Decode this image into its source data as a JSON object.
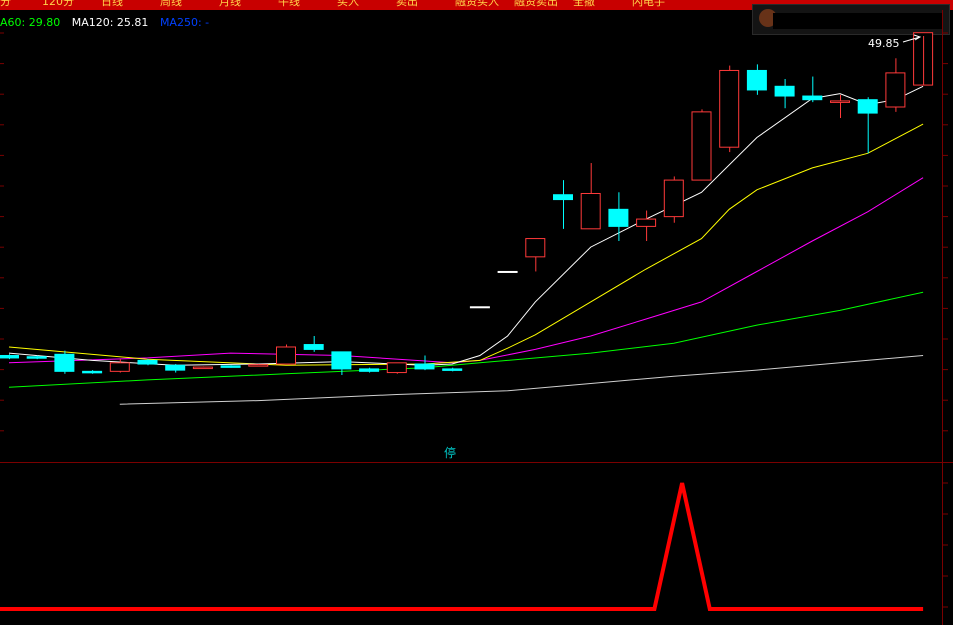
{
  "menu": [
    {
      "label": "分",
      "x": 0
    },
    {
      "label": "120分",
      "x": 42
    },
    {
      "label": "日线",
      "x": 108
    },
    {
      "label": "周线",
      "x": 168
    },
    {
      "label": "月线",
      "x": 232
    },
    {
      "label": "牛线",
      "x": 292
    },
    {
      "label": "买入",
      "x": 356
    },
    {
      "label": "卖出",
      "x": 416
    },
    {
      "label": "融资买入",
      "x": 466
    },
    {
      "label": "融资卖出",
      "x": 530
    },
    {
      "label": "全撤",
      "x": 604
    },
    {
      "label": "闪电手",
      "x": 658
    }
  ],
  "indicators": {
    "ma60": "A60: 29.80",
    "ma120": "MA120: 25.81",
    "ma250": "MA250: -"
  },
  "colors": {
    "ma60": "#00ff00",
    "ma120": "#ffffff",
    "ma250": "#0000ff",
    "up": "#ff3a3a",
    "down": "#00ffff",
    "ma5": "#ffffff",
    "ma10": "#ffff00",
    "ma20": "#ff00ff",
    "ma60_line": "#00ff00",
    "ma120_line": "#d0d0d0",
    "indicator_line": "#ff0000"
  },
  "price_marker": "49.85",
  "stop_label": "停",
  "chart_data": {
    "type": "candlestick",
    "y_range": [
      17.5,
      50.5
    ],
    "candles": [
      {
        "o": 24.6,
        "h": 24.7,
        "l": 24.3,
        "c": 24.4
      },
      {
        "o": 24.5,
        "h": 24.6,
        "l": 24.3,
        "c": 24.45
      },
      {
        "o": 24.7,
        "h": 25.0,
        "l": 23.1,
        "c": 23.3
      },
      {
        "o": 23.3,
        "h": 23.4,
        "l": 23.1,
        "c": 23.25
      },
      {
        "o": 23.3,
        "h": 24.3,
        "l": 23.2,
        "c": 24.0
      },
      {
        "o": 24.2,
        "h": 24.3,
        "l": 23.8,
        "c": 23.9
      },
      {
        "o": 23.8,
        "h": 23.9,
        "l": 23.2,
        "c": 23.4
      },
      {
        "o": 23.6,
        "h": 23.7,
        "l": 23.5,
        "c": 23.65
      },
      {
        "o": 23.75,
        "h": 23.8,
        "l": 23.6,
        "c": 23.7
      },
      {
        "o": 23.8,
        "h": 23.9,
        "l": 23.7,
        "c": 23.85
      },
      {
        "o": 23.9,
        "h": 25.5,
        "l": 23.9,
        "c": 25.3
      },
      {
        "o": 25.5,
        "h": 26.2,
        "l": 24.9,
        "c": 25.1
      },
      {
        "o": 24.9,
        "h": 24.9,
        "l": 23.0,
        "c": 23.5
      },
      {
        "o": 23.5,
        "h": 23.6,
        "l": 23.2,
        "c": 23.3
      },
      {
        "o": 23.2,
        "h": 24.0,
        "l": 23.1,
        "c": 24.0
      },
      {
        "o": 23.9,
        "h": 24.6,
        "l": 23.4,
        "c": 23.5
      },
      {
        "o": 23.5,
        "h": 23.6,
        "l": 23.3,
        "c": 23.4
      },
      {
        "o": 28.6,
        "h": 28.6,
        "l": 28.6,
        "c": 28.6
      },
      {
        "o": 31.5,
        "h": 31.5,
        "l": 31.5,
        "c": 31.5
      },
      {
        "o": 32.7,
        "h": 33.5,
        "l": 31.5,
        "c": 34.2
      },
      {
        "o": 37.8,
        "h": 39.0,
        "l": 35.0,
        "c": 37.4
      },
      {
        "o": 35.0,
        "h": 40.4,
        "l": 35.0,
        "c": 37.9
      },
      {
        "o": 36.6,
        "h": 38.0,
        "l": 34.0,
        "c": 35.2
      },
      {
        "o": 35.2,
        "h": 36.5,
        "l": 34.0,
        "c": 35.8
      },
      {
        "o": 36.0,
        "h": 39.3,
        "l": 35.5,
        "c": 39.0
      },
      {
        "o": 39.0,
        "h": 44.8,
        "l": 39.0,
        "c": 44.6
      },
      {
        "o": 41.7,
        "h": 48.4,
        "l": 41.3,
        "c": 48.0
      },
      {
        "o": 48.0,
        "h": 48.5,
        "l": 46.0,
        "c": 46.4
      },
      {
        "o": 46.7,
        "h": 47.3,
        "l": 44.9,
        "c": 45.9
      },
      {
        "o": 45.9,
        "h": 47.5,
        "l": 45.4,
        "c": 45.6
      },
      {
        "o": 45.4,
        "h": 46.0,
        "l": 44.1,
        "c": 45.5
      },
      {
        "o": 45.6,
        "h": 45.8,
        "l": 41.2,
        "c": 44.5
      },
      {
        "o": 45.0,
        "h": 49.0,
        "l": 44.6,
        "c": 47.8
      },
      {
        "o": 46.8,
        "h": 50.5,
        "l": 46.8,
        "c": 51.1
      }
    ],
    "ma5": [
      [
        0,
        24.8
      ],
      [
        3,
        24.2
      ],
      [
        6,
        23.8
      ],
      [
        9,
        23.9
      ],
      [
        12,
        24.1
      ],
      [
        15,
        23.8
      ],
      [
        16,
        23.9
      ],
      [
        17,
        24.6
      ],
      [
        18,
        26.2
      ],
      [
        19,
        29.0
      ],
      [
        21,
        33.5
      ],
      [
        23,
        35.8
      ],
      [
        25,
        38.0
      ],
      [
        27,
        42.5
      ],
      [
        29,
        45.7
      ],
      [
        30,
        46.1
      ],
      [
        31,
        45.2
      ],
      [
        32,
        45.6
      ],
      [
        33,
        46.7
      ]
    ],
    "ma10": [
      [
        0,
        25.3
      ],
      [
        5,
        24.3
      ],
      [
        10,
        23.8
      ],
      [
        15,
        23.9
      ],
      [
        17,
        24.2
      ],
      [
        18,
        25.2
      ],
      [
        19,
        26.3
      ],
      [
        21,
        29.0
      ],
      [
        23,
        31.7
      ],
      [
        25,
        34.2
      ],
      [
        26,
        36.6
      ],
      [
        27,
        38.2
      ],
      [
        29,
        40.0
      ],
      [
        31,
        41.2
      ],
      [
        33,
        43.6
      ]
    ],
    "ma20": [
      [
        0,
        24.0
      ],
      [
        5,
        24.4
      ],
      [
        8,
        24.8
      ],
      [
        12,
        24.6
      ],
      [
        16,
        24.0
      ],
      [
        17,
        24.2
      ],
      [
        19,
        25.1
      ],
      [
        21,
        26.2
      ],
      [
        23,
        27.6
      ],
      [
        25,
        29.0
      ],
      [
        27,
        31.5
      ],
      [
        29,
        34.0
      ],
      [
        31,
        36.4
      ],
      [
        33,
        39.2
      ]
    ],
    "ma60": [
      [
        0,
        22.0
      ],
      [
        5,
        22.6
      ],
      [
        10,
        23.1
      ],
      [
        15,
        23.6
      ],
      [
        17,
        24.0
      ],
      [
        21,
        24.8
      ],
      [
        24,
        25.6
      ],
      [
        27,
        27.1
      ],
      [
        30,
        28.3
      ],
      [
        33,
        29.8
      ]
    ],
    "ma120": [
      [
        4,
        20.6
      ],
      [
        9,
        20.9
      ],
      [
        14,
        21.4
      ],
      [
        18,
        21.7
      ],
      [
        21,
        22.3
      ],
      [
        24,
        22.9
      ],
      [
        27,
        23.4
      ],
      [
        30,
        24.0
      ],
      [
        33,
        24.6
      ]
    ],
    "indicator": {
      "y_range": [
        0,
        1
      ],
      "points": [
        [
          0,
          0
        ],
        [
          23.3,
          0
        ],
        [
          24.3,
          1
        ],
        [
          25.3,
          0
        ],
        [
          33,
          0
        ]
      ]
    }
  }
}
